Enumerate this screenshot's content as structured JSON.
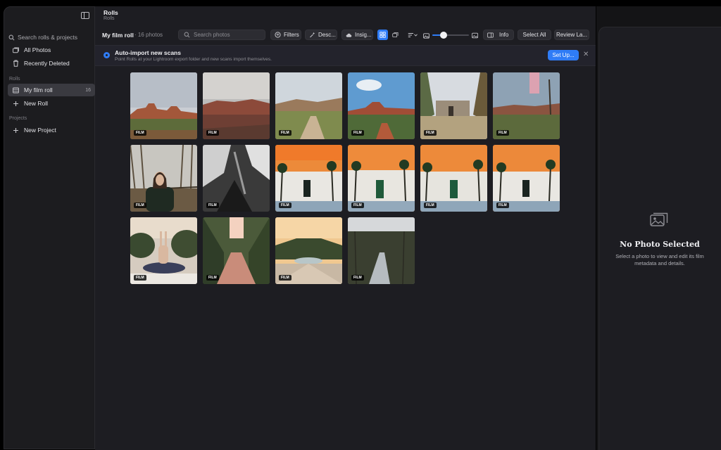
{
  "sidebar": {
    "search_placeholder": "Search rolls & projects",
    "items_top": [
      {
        "label": "All Photos",
        "icon": "photos-icon"
      },
      {
        "label": "Recently Deleted",
        "icon": "trash-icon"
      }
    ],
    "rolls_section": "Rolls",
    "rolls": [
      {
        "label": "My film roll",
        "count": "16",
        "icon": "film-roll-icon",
        "active": true
      },
      {
        "label": "New Roll",
        "icon": "plus-icon"
      }
    ],
    "projects_section": "Projects",
    "projects": [
      {
        "label": "New Project",
        "icon": "plus-icon"
      }
    ]
  },
  "header": {
    "title": "Rolls",
    "subtitle": "Rolls"
  },
  "toolbar": {
    "roll_name": "My film roll",
    "photo_count": "· 16 photos",
    "search_placeholder": "Search photos",
    "filters_label": "Filters",
    "describe_label": "Desc...",
    "insights_label": "Insig...",
    "info_label": "Info",
    "select_all_label": "Select All",
    "review_label": "Review La...",
    "thumb_size": 0.3,
    "accent_color": "#2f7cf6"
  },
  "banner": {
    "title": "Auto-import new scans",
    "text": "Point Rolls at your Lightroom export folder and new scans import themselves.",
    "setup_label": "Set Up..."
  },
  "photos": [
    {
      "tag": "FILM",
      "scene": "red-rock-butte"
    },
    {
      "tag": "FILM",
      "scene": "red-valley-cloudy"
    },
    {
      "tag": "FILM",
      "scene": "desert-trail"
    },
    {
      "tag": "FILM",
      "scene": "red-rock-blue-sky"
    },
    {
      "tag": "FILM",
      "scene": "stone-cabin"
    },
    {
      "tag": "FILM",
      "scene": "desert-light-leak"
    },
    {
      "tag": "FILM",
      "scene": "portrait-woman"
    },
    {
      "tag": "FILM",
      "scene": "bw-rocks"
    },
    {
      "tag": "FILM",
      "scene": "orange-sky-villa"
    },
    {
      "tag": "FILM",
      "scene": "orange-sky-villa-green-door"
    },
    {
      "tag": "FILM",
      "scene": "orange-sky-villa-green-door-2"
    },
    {
      "tag": "FILM",
      "scene": "orange-sky-villa-2"
    },
    {
      "tag": "FILM",
      "scene": "rabbit-sculpture"
    },
    {
      "tag": "FILM",
      "scene": "tree-lined-path"
    },
    {
      "tag": "FILM",
      "scene": "fountain-garden"
    },
    {
      "tag": "FILM",
      "scene": "forest-creek"
    }
  ],
  "details": {
    "title": "No Photo Selected",
    "text": "Select a photo to view and edit its film metadata and details."
  }
}
